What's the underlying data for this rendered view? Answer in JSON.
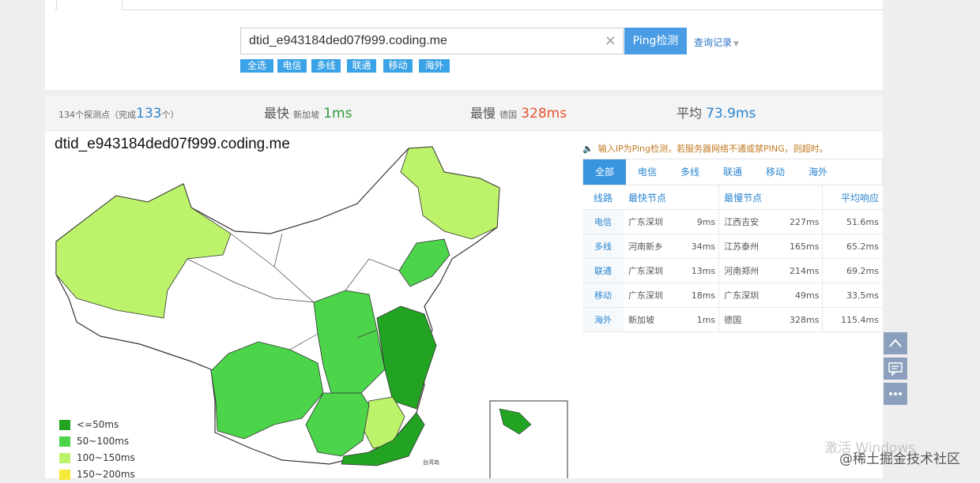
{
  "colors": {
    "accent": "#3a95e0",
    "tier1": "#22a321",
    "tier2": "#4cd44a",
    "tier3": "#bdf26b",
    "tier4": "#f5e93a"
  },
  "top": {
    "search": {
      "value": "dtid_e943184ded07f999.coding.me",
      "clear_icon": "×"
    },
    "ping_button": "Ping检测",
    "history_label": "查询记录",
    "filters": [
      "全选",
      "电信",
      "多线",
      "联通",
      "移动",
      "海外"
    ]
  },
  "stats": {
    "probe_prefix": "134个探测点（完成",
    "completed": "133",
    "probe_suffix": "个）",
    "fastest_label": "最快",
    "fastest_place": "新加坡",
    "fastest_value": "1ms",
    "slowest_label": "最慢",
    "slowest_place": "德国",
    "slowest_value": "328ms",
    "avg_label": "平均",
    "avg_value": "73.9ms"
  },
  "map": {
    "title": "dtid_e943184ded07f999.coding.me",
    "legend": [
      {
        "label": "<=50ms",
        "color": "#22a321"
      },
      {
        "label": "50~100ms",
        "color": "#4cd44a"
      },
      {
        "label": "100~150ms",
        "color": "#bdf26b"
      },
      {
        "label": "150~200ms",
        "color": "#f5e93a"
      }
    ],
    "inset_label": "台湾岛"
  },
  "notice": "输入IP为Ping检测，若服务器网络不通或禁PING，则超时。",
  "result": {
    "tabs": [
      "全部",
      "电信",
      "多线",
      "联通",
      "移动",
      "海外"
    ],
    "headers": {
      "line": "线路",
      "fastest": "最快节点",
      "slowest": "最慢节点",
      "avg": "平均响应"
    },
    "rows": [
      {
        "line": "电信",
        "fast_loc": "广东深圳",
        "fast_ms": "9ms",
        "slow_loc": "江西吉安",
        "slow_ms": "227ms",
        "avg": "51.6ms"
      },
      {
        "line": "多线",
        "fast_loc": "河南新乡",
        "fast_ms": "34ms",
        "slow_loc": "江苏泰州",
        "slow_ms": "165ms",
        "avg": "65.2ms"
      },
      {
        "line": "联通",
        "fast_loc": "广东深圳",
        "fast_ms": "13ms",
        "slow_loc": "河南郑州",
        "slow_ms": "214ms",
        "avg": "69.2ms"
      },
      {
        "line": "移动",
        "fast_loc": "广东深圳",
        "fast_ms": "18ms",
        "slow_loc": "广东深圳",
        "slow_ms": "49ms",
        "avg": "33.5ms"
      },
      {
        "line": "海外",
        "fast_loc": "新加坡",
        "fast_ms": "1ms",
        "slow_loc": "德国",
        "slow_ms": "328ms",
        "avg": "115.4ms"
      }
    ]
  },
  "watermark": "激活 Windows",
  "credit": "@稀土掘金技术社区"
}
